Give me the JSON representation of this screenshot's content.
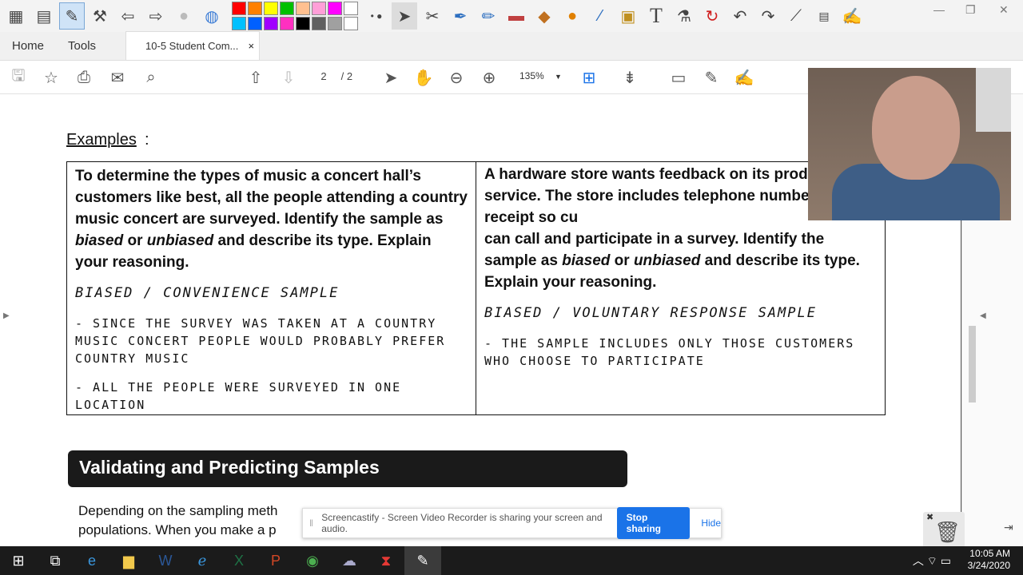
{
  "annotation_toolbar": {
    "left_tools": [
      "grid-icon",
      "card-icon",
      "pen-window-icon",
      "tools-icon",
      "back-icon",
      "forward-icon",
      "play-icon",
      "globe-icon"
    ],
    "palette_colors": [
      "#ff0000",
      "#ff8000",
      "#ffff00",
      "#00c000",
      "#ffc090",
      "#ff9fd8",
      "#ff00ff",
      "#ffffff",
      "#00c0ff",
      "#0060ff",
      "#a000ff",
      "#ff30c0",
      "#000000",
      "#606060",
      "#a0a0a0",
      "#ffffff"
    ],
    "right_tools": [
      "arrow-cursor-icon",
      "settings-icon",
      "pen-icon",
      "highlighter-icon",
      "eraser-icon",
      "fill-icon",
      "shape-icon",
      "eyedropper-icon",
      "clapper-icon",
      "text-icon",
      "flask-icon",
      "refresh-icon",
      "undo-icon",
      "redo-icon",
      "ruler-icon",
      "page-icon",
      "pen-tool-icon"
    ],
    "text_tool_label": "T"
  },
  "tabs": {
    "home": "Home",
    "tools": "Tools",
    "document": "10-5 Student Com...",
    "close": "×"
  },
  "pdf_toolbar": {
    "current_page": "2",
    "total_pages": "/ 2",
    "zoom": "135%"
  },
  "document": {
    "examples_heading": "Examples",
    "examples_colon": ":",
    "left_problem": [
      "To determine the types of music a concert hall’s customers like best, all the people attending a country music concert are surveyed. Identify the sample as ",
      "biased",
      " or ",
      "unbiased",
      " and describe its type. Explain your reasoning."
    ],
    "left_answer_title": "Biased / Convenience Sample",
    "left_answer_points": [
      "- Since the survey was taken at a country music concert people would probably prefer country music",
      "- All the people were surveyed in one location"
    ],
    "right_problem": [
      "A hardware store wants feedback on its products and service. The store includes telephone number on each receipt so cu",
      "can call and participate in a survey. Identify the sample as ",
      "biased",
      " or ",
      "unbiased",
      " and describe its type. Explain your reasoning."
    ],
    "right_answer_title": "Biased / Voluntary Response Sample",
    "right_answer_points": [
      "- The sample includes only those customers who choose to participate"
    ],
    "banner": "Validating and Predicting Samples",
    "body_line1": "Depending on the sampling meth",
    "body_line2": "populations. When you make a p"
  },
  "share_bar": {
    "message": "Screencastify - Screen Video Recorder is sharing your screen and audio.",
    "stop_label": "Stop sharing",
    "hide_label": "Hide"
  },
  "taskbar": {
    "apps": [
      "windows-start-icon",
      "task-view-icon",
      "edge-icon",
      "file-explorer-icon",
      "word-icon",
      "ie-icon",
      "excel-icon",
      "powerpoint-icon",
      "chrome-icon",
      "cloud-app-icon",
      "acrobat-icon",
      "annotate-app-icon"
    ],
    "time": "10:05 AM",
    "date": "3/24/2020"
  }
}
